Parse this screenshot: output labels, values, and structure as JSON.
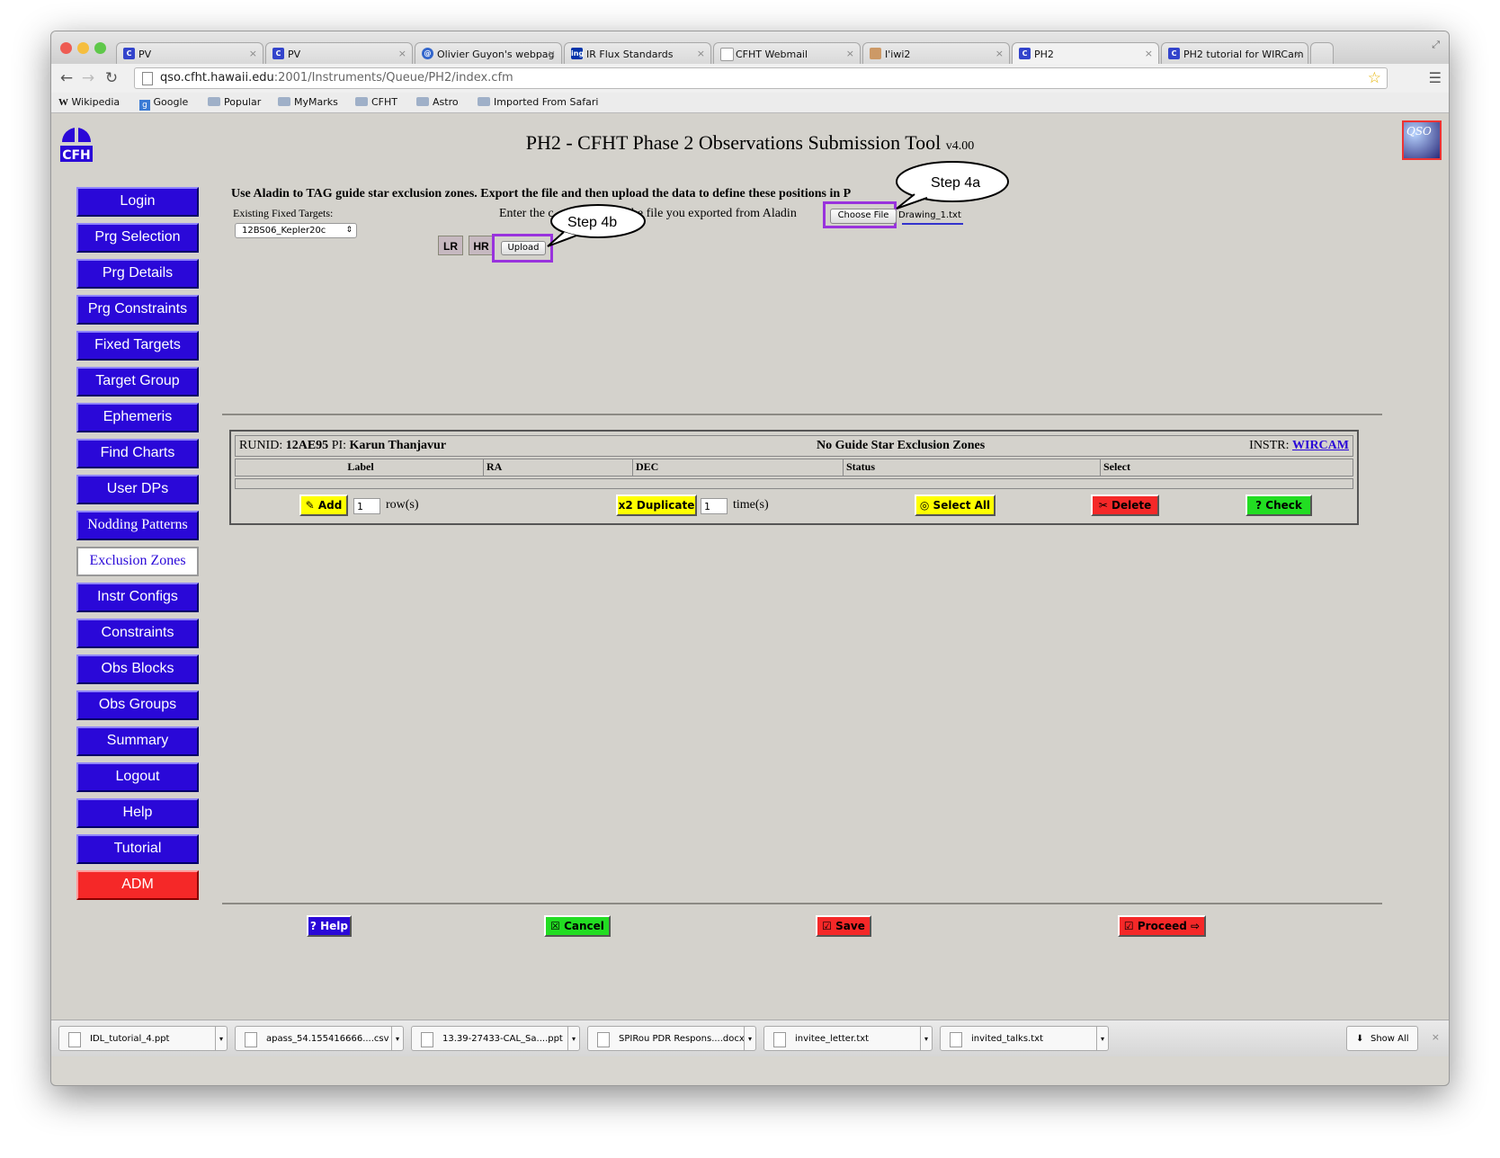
{
  "browser": {
    "tabs": [
      {
        "label": "PV",
        "icon": "cfht-icon"
      },
      {
        "label": "PV",
        "icon": "cfht-icon"
      },
      {
        "label": "Olivier Guyon's webpag",
        "icon": "globe-icon"
      },
      {
        "label": "IR Flux Standards",
        "icon": "ing-icon"
      },
      {
        "label": "CFHT Webmail",
        "icon": "page-icon"
      },
      {
        "label": "I'iwi2",
        "icon": "image-icon"
      },
      {
        "label": "PH2",
        "icon": "cfht-icon"
      },
      {
        "label": "PH2 tutorial for WIRCam",
        "icon": "cfht-icon"
      }
    ],
    "url_host": "qso.cfht.hawaii.edu",
    "url_path": ":2001/Instruments/Queue/PH2/index.cfm",
    "bookmarks": [
      "Wikipedia",
      "Google",
      "Popular",
      "MyMarks",
      "CFHT",
      "Astro",
      "Imported From Safari"
    ]
  },
  "header": {
    "title": "PH2 - CFHT Phase 2 Observations Submission Tool",
    "version": "v4.00",
    "logo_text": "CFH",
    "qso_text": "QSO"
  },
  "nav": {
    "items": [
      "Login",
      "Prg Selection",
      "Prg Details",
      "Prg Constraints",
      "Fixed Targets",
      "Target Group",
      "Ephemeris",
      "Find Charts",
      "User DPs",
      "Nodding Patterns",
      "Exclusion Zones",
      "Instr Configs",
      "Constraints",
      "Obs Blocks",
      "Obs Groups",
      "Summary",
      "Logout",
      "Help",
      "Tutorial",
      "ADM"
    ]
  },
  "upload": {
    "instructions": "Use Aladin to TAG guide star exclusion zones. Export the file and then upload the data to define these positions in P",
    "existing_label": "Existing Fixed Targets:",
    "existing_value": "12BS06_Kepler20c",
    "lr_label": "LR",
    "hr_label": "HR",
    "enter_text": "Enter the c",
    "enter_text_tail": "to the file you exported from Aladin",
    "choose_file": "Choose File",
    "file_name": "Drawing_1.txt",
    "upload_label": "Upload",
    "step_4a": "Step 4a",
    "step_4b": "Step 4b"
  },
  "table": {
    "runid_label": "RUNID:",
    "runid": "12AE95",
    "pi_label": "PI:",
    "pi": "Karun Thanjavur",
    "status": "No Guide Star Exclusion Zones",
    "instr_label": "INSTR:",
    "instr": "WIRCAM",
    "columns": [
      "Label",
      "RA",
      "DEC",
      "Status",
      "Select"
    ],
    "add_label": "Add",
    "add_count": "1",
    "rows_label": "row(s)",
    "duplicate_label": "x2 Duplicate",
    "dup_count": "1",
    "times_label": "time(s)",
    "select_all_label": "Select All",
    "delete_label": "Delete",
    "check_label": "? Check"
  },
  "footer": {
    "help": "? Help",
    "cancel": "Cancel",
    "save": "Save",
    "proceed": "Proceed"
  },
  "downloads": {
    "items": [
      "IDL_tutorial_4.ppt",
      "apass_54.155416666....csv",
      "13.39-27433-CAL_Sa....ppt",
      "SPIRou PDR Respons....docx",
      "invitee_letter.txt",
      "invited_talks.txt"
    ],
    "show_all": "Show All"
  },
  "colors": {
    "nav_blue": "#2a08d8",
    "adm_red": "#f52828",
    "add_yellow": "#ffff00",
    "delete_red": "#f52828",
    "check_green": "#22dd22",
    "highlight_purple": "#9933dd"
  }
}
